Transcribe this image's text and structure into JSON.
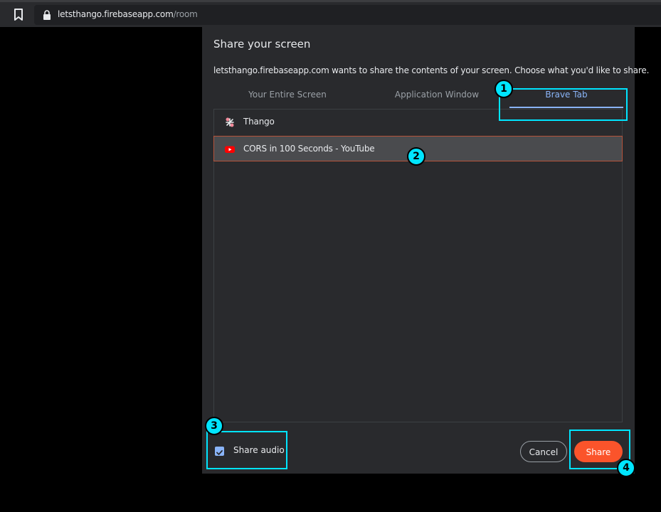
{
  "browser": {
    "url_host": "letsthango.firebaseapp.com",
    "url_path": "/room",
    "bookmark_icon": "bookmark-icon",
    "lock_icon": "lock-icon"
  },
  "dialog": {
    "title": "Share your screen",
    "description": "letsthango.firebaseapp.com wants to share the contents of your screen. Choose what you'd like to share.",
    "tabs": [
      {
        "label": "Your Entire Screen",
        "selected": false
      },
      {
        "label": "Application Window",
        "selected": false
      },
      {
        "label": "Brave Tab",
        "selected": true
      }
    ],
    "items": [
      {
        "label": "Thango",
        "icon": "thango-favicon-icon",
        "selected": false
      },
      {
        "label": "CORS in 100 Seconds - YouTube",
        "icon": "youtube-icon",
        "selected": true
      }
    ],
    "share_audio_label": "Share audio",
    "share_audio_checked": true,
    "cancel_label": "Cancel",
    "share_label": "Share"
  },
  "annotations": [
    "1",
    "2",
    "3",
    "4"
  ],
  "colors": {
    "accent": "#8ab4f8",
    "share_button": "#fb542b",
    "highlight": "#00e5ff"
  }
}
